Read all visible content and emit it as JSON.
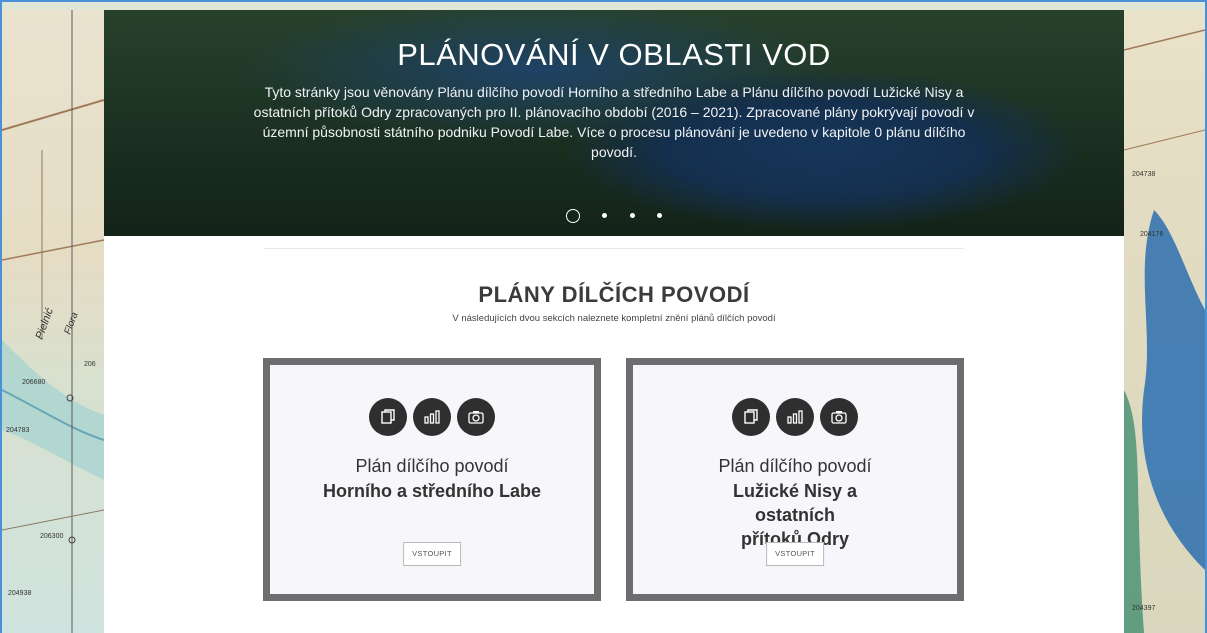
{
  "hero": {
    "title": "PLÁNOVÁNÍ V OBLASTI VOD",
    "text": "Tyto stránky jsou věnovány Plánu dílčího povodí Horního a středního Labe a Plánu dílčího povodí Lužické Nisy a ostatních přítoků Odry zpracovaných pro II. plánovacího období (2016 – 2021). Zpracované plány pokrývají povodí v územní působnosti státního podniku Povodí Labe. Více o procesu plánování je uvedeno v kapitole 0 plánu dílčího povodí.",
    "slides": 4,
    "active_slide": 1
  },
  "section": {
    "title": "PLÁNY DÍLČÍCH POVODÍ",
    "subtitle": "V následujících dvou sekcích naleznete kompletní znění plánů dílčích povodí"
  },
  "cards": [
    {
      "line1": "Plán dílčího povodí",
      "line2": "Horního a středního Labe",
      "button": "VSTOUPIT",
      "icons": [
        "documents-icon",
        "chart-icon",
        "camera-icon"
      ]
    },
    {
      "line1": "Plán dílčího povodí",
      "line2": "Lužické Nisy a ostatních přítoků Odry",
      "button": "VSTOUPIT",
      "icons": [
        "documents-icon",
        "chart-icon",
        "camera-icon"
      ]
    }
  ],
  "map_labels": {
    "left": [
      "Pielnić",
      "Flora",
      "206",
      "206680",
      "204783",
      "206300",
      "204938"
    ],
    "right": [
      "204738",
      "204176",
      "204397"
    ]
  },
  "colors": {
    "card_border": "#6d6d70",
    "icon_bg": "#2f2f2f",
    "frame": "#4a90d9"
  }
}
